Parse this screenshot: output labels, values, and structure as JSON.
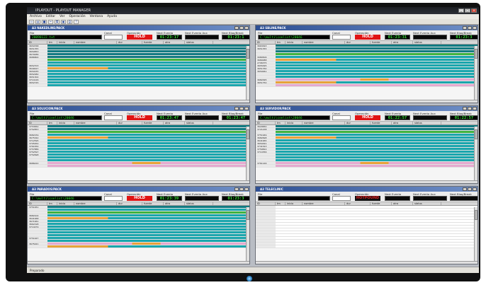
{
  "app": {
    "title": "IPLAYOUT - PLAYOUT MANAGER",
    "menu": [
      "Archivo",
      "Editar",
      "Ver",
      "Operación",
      "Ventana",
      "Ayuda"
    ],
    "status": "Preparado"
  },
  "labels": {
    "file": "File",
    "canal": "Canal",
    "operacion": "Operación",
    "next_evento": "Next Evento",
    "next_evento_aux": "Next Evento Aux",
    "next_bloq": "Next Bloq/Break"
  },
  "grid_headers": [
    "ID",
    "tm",
    "inicio",
    "nombre",
    "dur",
    "fuente",
    "otra",
    "status"
  ],
  "windows": [
    {
      "title": "A3 NAKEDLINE/PACK",
      "file": "20090122.txt",
      "operacion": "HOLD",
      "next_evento": "01:23:17",
      "next_evento_aux": "",
      "next_bloq": "01:23:1",
      "row_ids": [
        "3650768",
        "3651355",
        "3650853",
        "3679286",
        "3686800",
        "",
        "",
        "3652703",
        "3649427",
        "3650035",
        "3652082",
        "3651302",
        "3714126",
        "3652745"
      ],
      "row_styles": [
        "dteal",
        "dteal",
        "dteal",
        "dteal",
        "dteal",
        "green",
        "teal",
        "teal",
        "orange",
        "teal",
        "teal",
        "teal",
        "teal",
        "teal",
        "teal"
      ]
    },
    {
      "title": "A3 SBLINE/PACK",
      "file": "C:\\multi\\conlist\\20046",
      "operacion": "HOLD",
      "next_evento": "01:23:31",
      "next_evento_aux": "",
      "next_bloq": "01:23:3",
      "row_ids": [
        "3663093",
        "3651355",
        "",
        "",
        "3080506",
        "3680088",
        "2706375",
        "3655095",
        "3651760",
        "3650061",
        "",
        "",
        "3682095",
        "3651750"
      ],
      "row_styles": [
        "dteal",
        "dteal",
        "dteal",
        "green",
        "teal",
        "orange",
        "teal",
        "teal",
        "teal",
        "teal",
        "teal",
        "teal",
        "pinko",
        "orange",
        "pink"
      ]
    },
    {
      "title": "A3 SOLUCION/PACK",
      "file": "C:\\multi\\conlist\\20046",
      "operacion": "HOLD",
      "next_evento": "01:23:47",
      "next_evento_aux": "",
      "next_bloq": "01:23:47",
      "row_ids": [
        "3753652",
        "3752853",
        "",
        "3682159",
        "3675342",
        "3712595",
        "3705954",
        "3761834",
        "3757886",
        "3752597",
        "3752698",
        "",
        "",
        "3686222"
      ],
      "row_styles": [
        "dteal",
        "dteal",
        "green",
        "teal",
        "orange",
        "teal",
        "teal",
        "teal",
        "teal",
        "teal",
        "teal",
        "teal",
        "teal",
        "pinko",
        "pink"
      ]
    },
    {
      "title": "A3 SERVIDOR/PACK",
      "file": "C:\\multi\\conlist\\20046",
      "operacion": "HOLD",
      "next_evento": "01:22:57",
      "next_evento_aux": "",
      "next_bloq": "01:22:57",
      "row_ids": [
        "3629650",
        "3721438",
        "",
        "3751949",
        "3682698",
        "3641965",
        "3654091",
        "3741543",
        "3759822",
        "3714356",
        "",
        "",
        "",
        "3761146"
      ],
      "row_styles": [
        "dteal",
        "dteal",
        "green",
        "teal",
        "orange",
        "teal",
        "teal",
        "teal",
        "teal",
        "teal",
        "teal",
        "teal",
        "teal",
        "pinko",
        "pink"
      ]
    },
    {
      "title": "A3 PARADOS/PACK",
      "file": "C:\\multi\\conlist\\20046",
      "operacion": "HOLD",
      "next_evento": "01:23:39",
      "next_evento_aux": "",
      "next_bloq": "01:23:3",
      "row_ids": [
        "3751951",
        "",
        "",
        "3682104",
        "3641968",
        "3671961",
        "3662198",
        "3714479",
        "",
        "",
        "",
        "3751927",
        "",
        "3675021"
      ],
      "row_styles": [
        "dteal",
        "teal",
        "green",
        "teal",
        "orange",
        "teal",
        "teal",
        "teal",
        "teal",
        "teal",
        "teal",
        "teal",
        "teal",
        "pinko",
        "orange"
      ]
    },
    {
      "title": "A3 TELECLINIC",
      "file": "",
      "operacion": "HOTPOUND",
      "next_evento": "",
      "next_evento_aux": "",
      "next_bloq": "",
      "row_ids": [],
      "row_styles": []
    }
  ]
}
